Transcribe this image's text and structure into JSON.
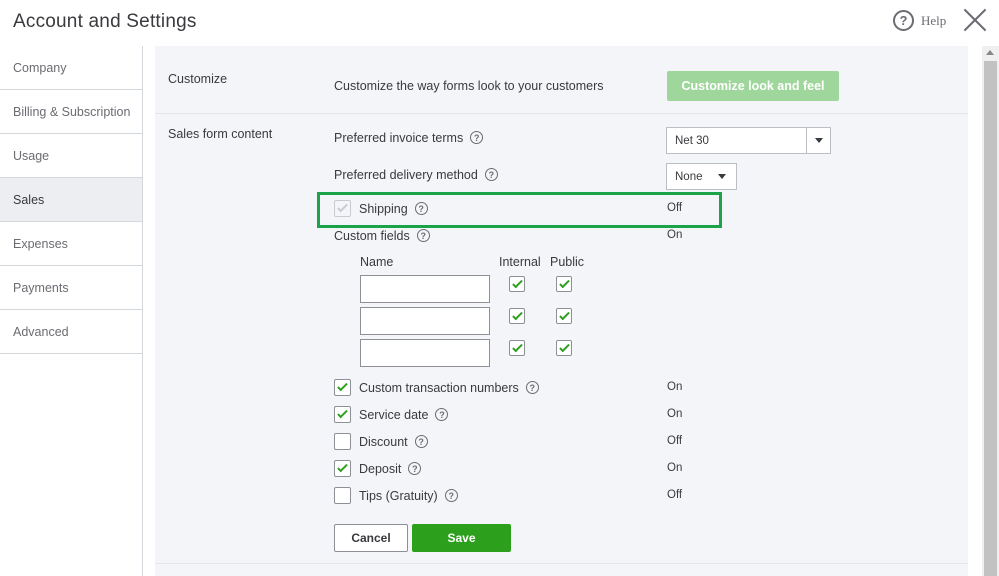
{
  "header": {
    "title": "Account and Settings",
    "help_label": "Help",
    "help_glyph": "?"
  },
  "sidebar": {
    "items": [
      {
        "label": "Company"
      },
      {
        "label": "Billing & Subscription"
      },
      {
        "label": "Usage"
      },
      {
        "label": "Sales",
        "active": true
      },
      {
        "label": "Expenses"
      },
      {
        "label": "Payments"
      },
      {
        "label": "Advanced"
      }
    ]
  },
  "customize": {
    "section_label": "Customize",
    "description": "Customize the way forms look to your customers",
    "button_label": "Customize look and feel"
  },
  "sales_form": {
    "section_label": "Sales form content",
    "invoice_terms": {
      "label": "Preferred invoice terms",
      "value": "Net 30"
    },
    "delivery_method": {
      "label": "Preferred delivery method",
      "value": "None"
    },
    "shipping": {
      "label": "Shipping",
      "status": "Off",
      "checked": true,
      "disabled": true
    },
    "custom_fields": {
      "label": "Custom fields",
      "status": "On",
      "col_name": "Name",
      "col_internal": "Internal",
      "col_public": "Public",
      "rows": [
        {
          "name": "",
          "internal": true,
          "public": true
        },
        {
          "name": "",
          "internal": true,
          "public": true
        },
        {
          "name": "",
          "internal": true,
          "public": true
        }
      ]
    },
    "options": [
      {
        "label": "Custom transaction numbers",
        "status": "On",
        "checked": true
      },
      {
        "label": "Service date",
        "status": "On",
        "checked": true
      },
      {
        "label": "Discount",
        "status": "Off",
        "checked": false
      },
      {
        "label": "Deposit",
        "status": "On",
        "checked": true
      },
      {
        "label": "Tips (Gratuity)",
        "status": "Off",
        "checked": false
      }
    ]
  },
  "actions": {
    "cancel_label": "Cancel",
    "save_label": "Save"
  },
  "colors": {
    "accent_green": "#2ca01c",
    "highlight_green": "#1aa34a",
    "disabled_button_green": "#9fd69c"
  }
}
